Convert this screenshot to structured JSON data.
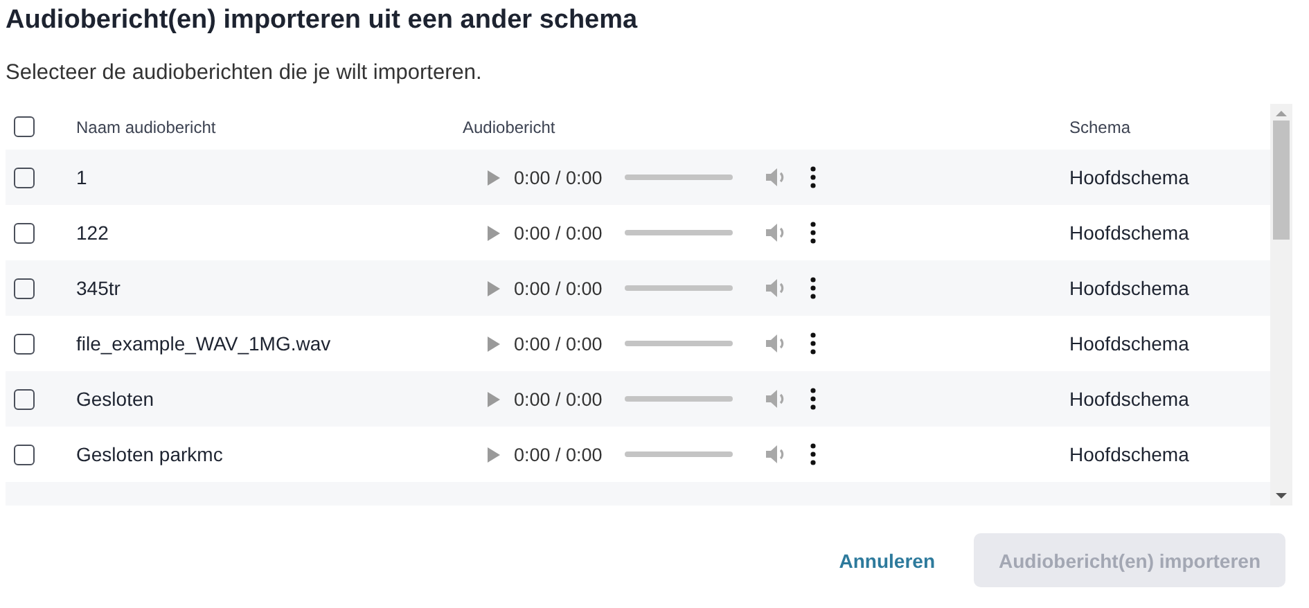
{
  "dialog": {
    "title": "Audiobericht(en) importeren uit een ander schema",
    "subtitle": "Selecteer de audioberichten die je wilt importeren."
  },
  "table": {
    "select_all": {
      "checked": false
    },
    "columns": [
      "Naam audiobericht",
      "Audiobericht",
      "Schema"
    ],
    "rows": [
      {
        "checked": false,
        "name": "1",
        "time": "0:00 / 0:00",
        "schema": "Hoofdschema"
      },
      {
        "checked": false,
        "name": "122",
        "time": "0:00 / 0:00",
        "schema": "Hoofdschema"
      },
      {
        "checked": false,
        "name": "345tr",
        "time": "0:00 / 0:00",
        "schema": "Hoofdschema"
      },
      {
        "checked": false,
        "name": "file_example_WAV_1MG.wav",
        "time": "0:00 / 0:00",
        "schema": "Hoofdschema"
      },
      {
        "checked": false,
        "name": "Gesloten",
        "time": "0:00 / 0:00",
        "schema": "Hoofdschema"
      },
      {
        "checked": false,
        "name": "Gesloten parkmc",
        "time": "0:00 / 0:00",
        "schema": "Hoofdschema"
      }
    ]
  },
  "buttons": [
    {
      "kind": "link",
      "label": "Annuleren"
    },
    {
      "kind": "primary",
      "label": "Audiobericht(en) importeren",
      "disabled": true
    }
  ]
}
